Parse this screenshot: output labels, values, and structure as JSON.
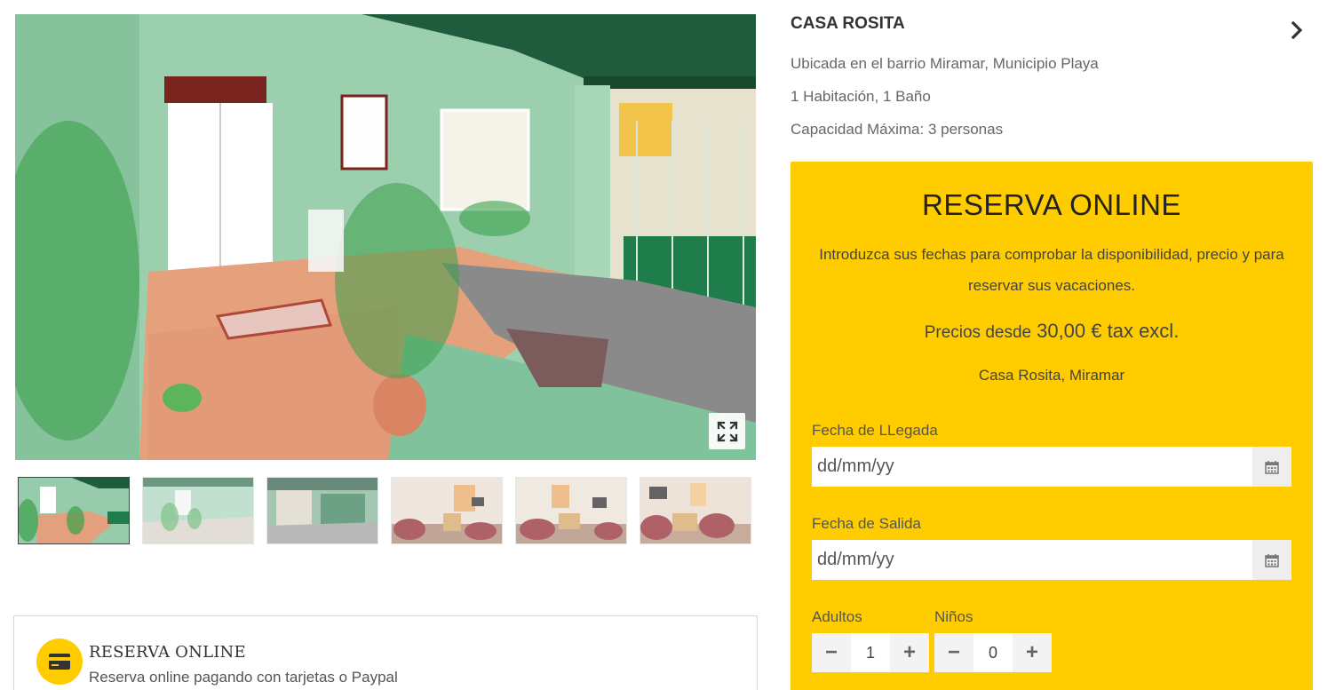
{
  "gallery": {
    "expand_icon": "expand-icon",
    "thumbnails": [
      {
        "name": "porch-front",
        "active": true
      },
      {
        "name": "porch-side",
        "active": false
      },
      {
        "name": "porch-gate",
        "active": false
      },
      {
        "name": "living-room-1",
        "active": false
      },
      {
        "name": "living-room-2",
        "active": false
      },
      {
        "name": "living-room-3",
        "active": false
      }
    ]
  },
  "property": {
    "title": "CASA ROSITA",
    "next_icon": "chevron-right-icon",
    "location_line": "Ubicada en el barrio Miramar, Municipio Playa",
    "rooms_line": "1 Habitación, 1 Baño",
    "capacity_line": "Capacidad Máxima: 3 personas"
  },
  "booking": {
    "title": "RESERVA ONLINE",
    "description": "Introduzca sus fechas para comprobar la disponibilidad, precio y para reservar sus vacaciones.",
    "price_label": "Precios desde",
    "price_value": "30,00 € tax excl.",
    "location": "Casa Rosita, Miramar",
    "arrival_label": "Fecha de LLegada",
    "arrival_placeholder": "dd/mm/yy",
    "departure_label": "Fecha de Salida",
    "departure_placeholder": "dd/mm/yy",
    "calendar_icon": "calendar-icon",
    "adults_label": "Adultos",
    "adults_value": "1",
    "children_label": "Niños",
    "children_value": "0",
    "minus_symbol": "−",
    "plus_symbol": "+"
  },
  "feature": {
    "icon": "credit-card-icon",
    "title": "RESERVA ONLINE",
    "subtitle": "Reserva online pagando con tarjetas o Paypal"
  },
  "colors": {
    "accent": "#ffcc00",
    "text_dark": "#333333",
    "text_muted": "#666666"
  }
}
